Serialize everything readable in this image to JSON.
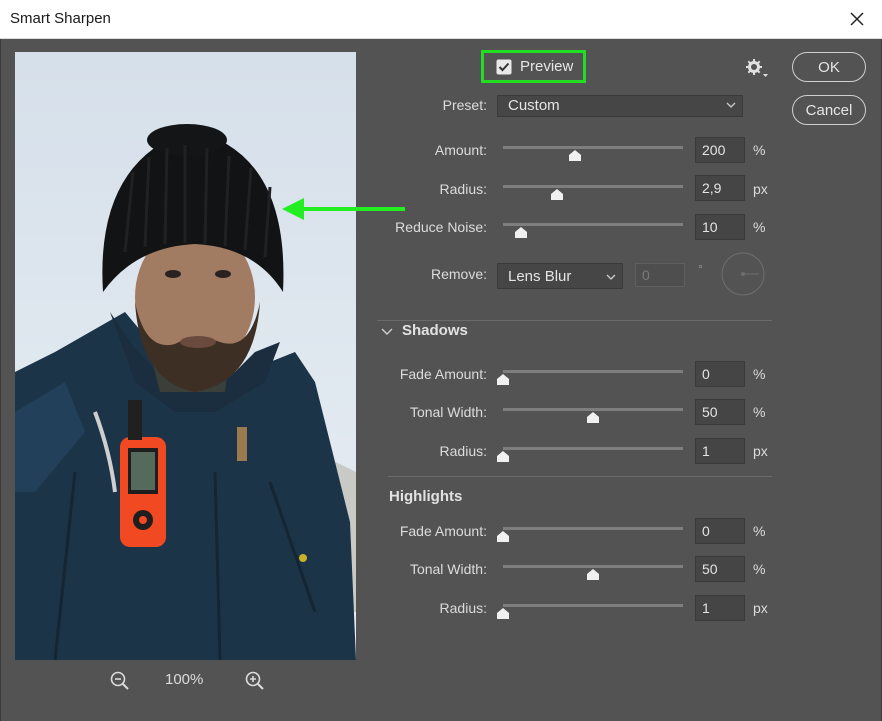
{
  "window": {
    "title": "Smart Sharpen"
  },
  "preview": {
    "label": "Preview",
    "checked": true
  },
  "buttons": {
    "ok": "OK",
    "cancel": "Cancel"
  },
  "preset": {
    "label": "Preset:",
    "value": "Custom"
  },
  "main": {
    "amount": {
      "label": "Amount:",
      "value": "200",
      "unit": "%",
      "level": 0.4
    },
    "radius": {
      "label": "Radius:",
      "value": "2,9",
      "unit": "px",
      "level": 0.3
    },
    "reduce_noise": {
      "label": "Reduce Noise:",
      "value": "10",
      "unit": "%",
      "level": 0.1
    },
    "remove": {
      "label": "Remove:",
      "value": "Lens Blur",
      "angle": "0",
      "degree": "°"
    }
  },
  "shadows": {
    "title": "Shadows",
    "fade_amount": {
      "label": "Fade Amount:",
      "value": "0",
      "unit": "%",
      "level": 0
    },
    "tonal_width": {
      "label": "Tonal Width:",
      "value": "50",
      "unit": "%",
      "level": 0.5
    },
    "radius": {
      "label": "Radius:",
      "value": "1",
      "unit": "px",
      "level": 0
    }
  },
  "highlights": {
    "title": "Highlights",
    "fade_amount": {
      "label": "Fade Amount:",
      "value": "0",
      "unit": "%",
      "level": 0
    },
    "tonal_width": {
      "label": "Tonal Width:",
      "value": "50",
      "unit": "%",
      "level": 0.5
    },
    "radius": {
      "label": "Radius:",
      "value": "1",
      "unit": "px",
      "level": 0
    }
  },
  "zoom": {
    "level": "100%"
  },
  "colors": {
    "highlight_box": "#22dd22",
    "arrow": "#22ee22",
    "dialog_bg": "#535353"
  }
}
